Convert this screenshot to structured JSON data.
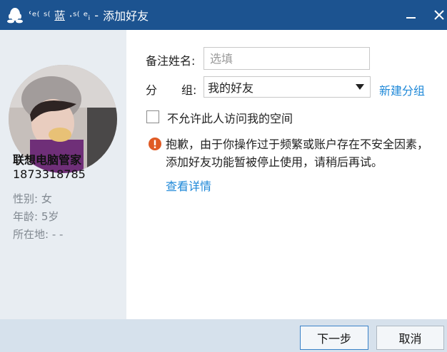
{
  "window": {
    "title_prefix": "ʿᵉ⁽ ˢ⁽ 蓝 ·ˢ⁽ ᵉᵢ",
    "title_separator": "-",
    "title": "添加好友",
    "accent_color": "#1c5390",
    "minimize_icon": "minimize-icon",
    "close_icon": "close-icon"
  },
  "profile": {
    "name": "联想电脑管家",
    "qq_number": "1873318785",
    "gender": "性别: 女",
    "age": "年龄: 5岁",
    "location": "所在地: -    -"
  },
  "form": {
    "remark_label": "备注姓名:",
    "remark_placeholder": "选填",
    "remark_value": "",
    "group_label_1": "分",
    "group_label_2": "组:",
    "group_value": "我的好友",
    "new_group_link": "新建分组",
    "deny_space_label": "不允许此人访问我的空间",
    "deny_space_checked": false,
    "warning_text": "抱歉，由于你操作过于频繁或账户存在不安全因素，添加好友功能暂被停止使用，请稍后再试。",
    "details_link": "查看详情",
    "link_color": "#1e88d8",
    "warning_color": "#e05a24"
  },
  "footer": {
    "next_label": "下一步",
    "cancel_label": "取消"
  }
}
